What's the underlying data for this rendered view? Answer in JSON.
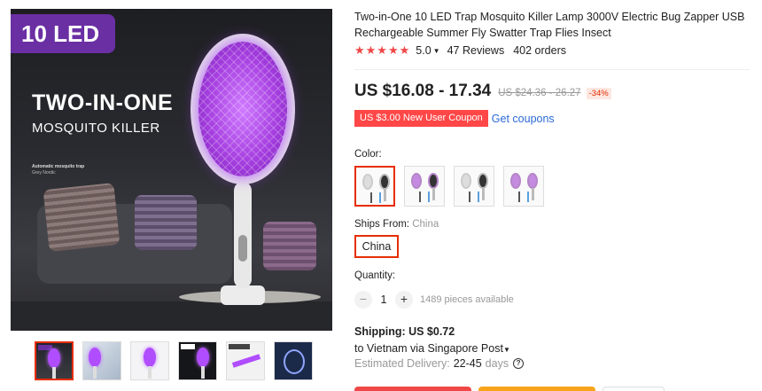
{
  "gallery": {
    "badge": "10 LED",
    "headline": "TWO-IN-ONE",
    "subline": "MOSQUITO KILLER",
    "small_text_1": "Automatic mosquito trap",
    "small_text_2": "Grey Nordic",
    "thumbnails": [
      "thumb-1",
      "thumb-2",
      "thumb-3",
      "thumb-4",
      "thumb-5",
      "thumb-6"
    ],
    "selected_thumbnail": 0
  },
  "product": {
    "title": "Two-in-One 10 LED Trap Mosquito Killer Lamp 3000V Electric Bug Zapper USB Rechargeable Summer Fly Swatter Trap Flies Insect",
    "stars": "★★★★★",
    "rating": "5.0",
    "reviews": "47 Reviews",
    "orders": "402 orders"
  },
  "price": {
    "current": "US $16.08 - 17.34",
    "original": "US $24.36 - 26.27",
    "discount": "-34%"
  },
  "coupon": {
    "label": "US $3.00 New User Coupon",
    "link": "Get coupons"
  },
  "options": {
    "color_label": "Color:",
    "ships_from_label": "Ships From:",
    "ships_from_value": "China",
    "ship_button": "China",
    "quantity_label": "Quantity:",
    "quantity_value": "1",
    "minus": "−",
    "plus": "+",
    "available": "1489 pieces available"
  },
  "shipping": {
    "cost": "Shipping: US $0.72",
    "destination": "to Vietnam via Singapore Post",
    "delivery_label": "Estimated Delivery:",
    "delivery_days": "22-45",
    "days_suffix": "days"
  },
  "colors": {
    "accent": "#e62e04",
    "coupon": "#ff4747",
    "link": "#2a6ad8",
    "star": "#f04747",
    "badge": "#6a2fa3"
  }
}
